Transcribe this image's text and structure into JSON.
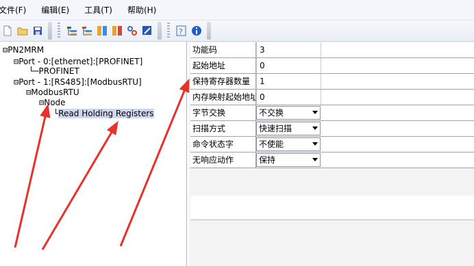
{
  "menu": {
    "file": "文件(F)",
    "edit": "编辑(E)",
    "tools": "工具(T)",
    "help": "帮助(H)"
  },
  "toolbar": {
    "icons": [
      "new-file-icon",
      "open-folder-icon",
      "save-icon",
      "add-port-icon",
      "add-node-icon",
      "add-command-icon",
      "remove-icon",
      "link-icon",
      "edit-icon",
      "help-icon",
      "info-icon"
    ]
  },
  "tree": {
    "root": "PN2MRM",
    "port0": "Port - 0:[ethernet]:[PROFINET]",
    "profinet": "PROFINET",
    "port1": "Port - 1:[RS485]:[ModbusRTU]",
    "modbusrtu": "ModbusRTU",
    "node": "Node",
    "command": "Read Holding Registers"
  },
  "properties": [
    {
      "name": "功能码",
      "value": "3",
      "type": "text"
    },
    {
      "name": "起始地址",
      "value": "0",
      "type": "text"
    },
    {
      "name": "保持寄存器数量",
      "value": "1",
      "type": "text"
    },
    {
      "name": "内存映射起始地址",
      "value": "0",
      "type": "text"
    },
    {
      "name": "字节交换",
      "value": "不交换",
      "type": "select"
    },
    {
      "name": "扫描方式",
      "value": "快速扫描",
      "type": "select"
    },
    {
      "name": "命令状态字",
      "value": "不使能",
      "type": "select"
    },
    {
      "name": "无响应动作",
      "value": "保持",
      "type": "select"
    }
  ],
  "colors": {
    "annotation_arrow": "#e8312a",
    "selection": "#cfd6f0"
  }
}
